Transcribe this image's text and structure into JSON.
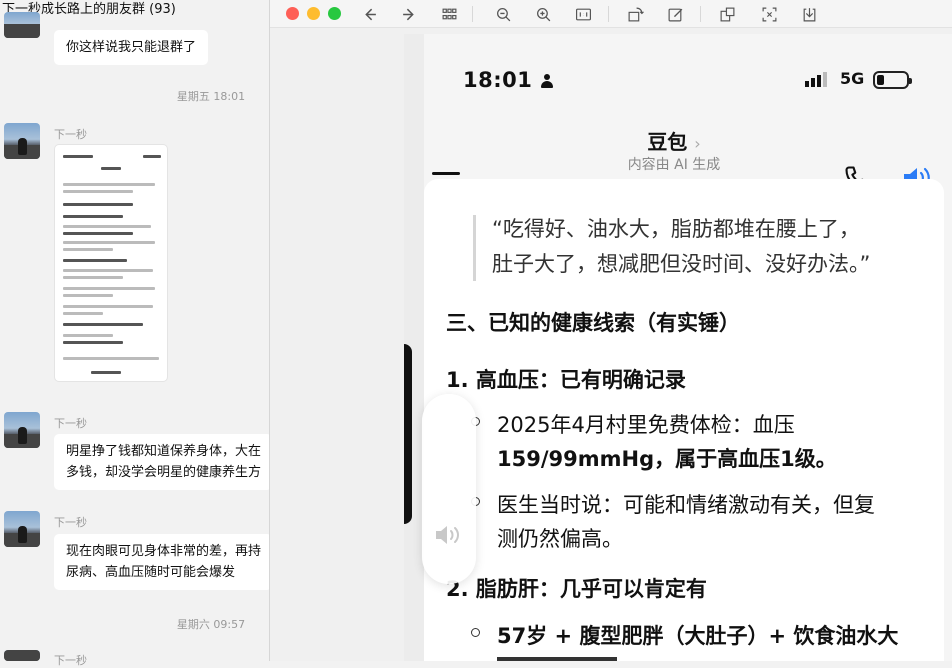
{
  "chat": {
    "title": "下一秒成长路上的朋友群 (93)",
    "top_bubble": "你这样说我只能退群了",
    "divider_1": "星期五 18:01",
    "sender_name": "下一秒",
    "msg_1": "明星挣了钱都知道保养身体，大在",
    "msg_1_line2": "多钱，却没学会明星的健康养生方",
    "msg_2": "现在肉眼可见身体非常的差，再持",
    "msg_2_line2": "尿病、高血压随时可能会爆发",
    "divider_2": "星期六 09:57"
  },
  "viewer": {
    "toolbar_icons": [
      "back-icon",
      "forward-icon",
      "grid-icon",
      "zoom-out-icon",
      "zoom-in-icon",
      "actual-size-icon",
      "rotate-icon",
      "markup-icon",
      "ocr-icon",
      "translate-icon",
      "download-icon"
    ]
  },
  "phone": {
    "time": "18:01",
    "network": "5G",
    "app_title": "豆包",
    "app_subtitle": "内容由 AI 生成",
    "quote_line1": "“吃得好、油水大，脂肪都堆在腰上了，",
    "quote_line2": "肚子大了，想减肥但没时间、没好办法。”",
    "section3_title": "三、已知的健康线索（有实锤）",
    "item1_title": "1. 高血压：已有明确记录",
    "item1_b1_line1": "2025年4月村里免费体检：血压",
    "item1_b1_line2": "159/99mmHg，属于高血压1级。",
    "item1_b2_line1": "医生当时说：可能和情绪激动有关，但复",
    "item1_b2_line2": "测仍然偏高。",
    "item2_title": "2. 脂肪肝：几乎可以肯定有",
    "item2_b1_line1": "57岁 + 腹型肥胖（大肚子）+ 饮食油水大"
  },
  "colors": {
    "accent": "#2b7cf6",
    "chat_bg": "#f2f2f2",
    "bubble": "#ffffff"
  }
}
